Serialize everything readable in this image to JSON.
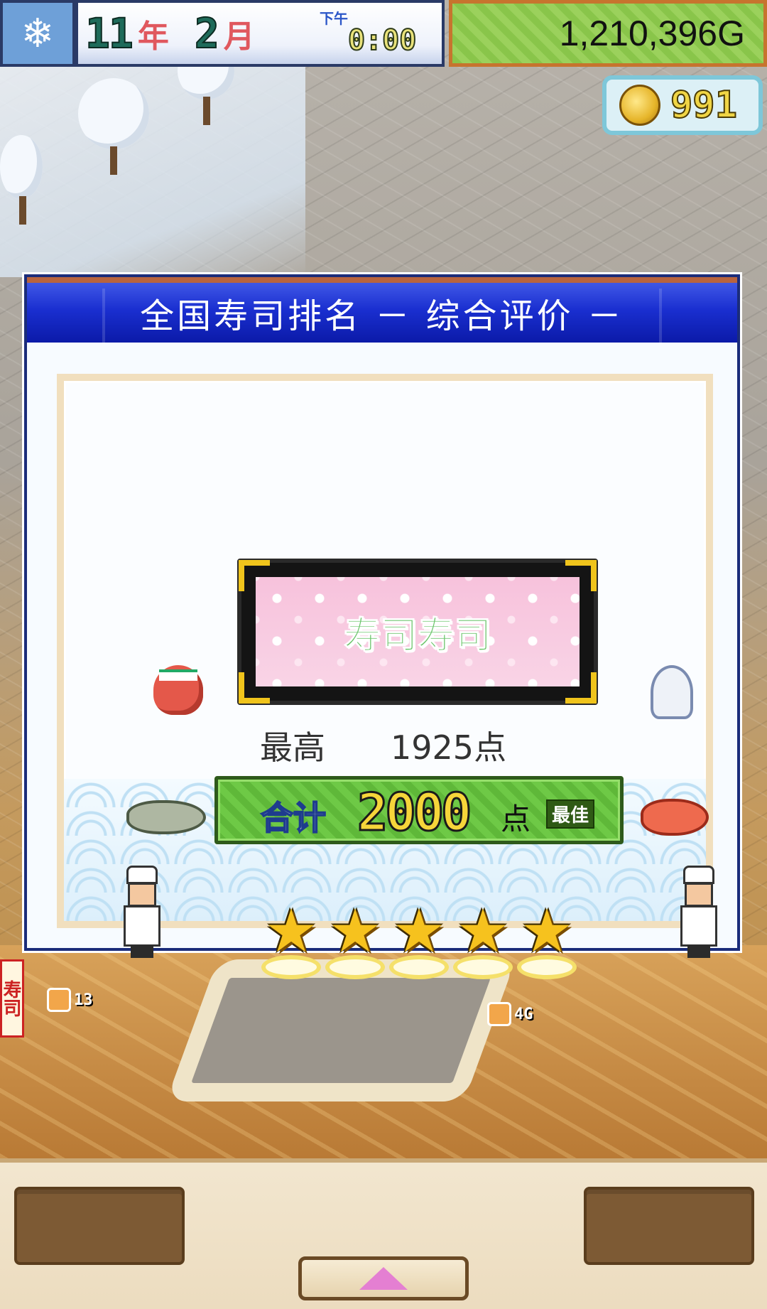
{
  "hud": {
    "weather_icon": "snowflake-icon",
    "year": "11",
    "year_unit": "年",
    "month": "2",
    "month_unit": "月",
    "period": "下午",
    "time": "0:00",
    "money": "1,210,396G",
    "coins": "991"
  },
  "world": {
    "side_banner": "寿司",
    "stall_badges": [
      "13",
      "4G"
    ]
  },
  "dialog": {
    "title": "全国寿司排名 － 综合评价 －",
    "shop_name": "寿司寿司",
    "best_label": "最高",
    "best_value": "1925点",
    "total_label": "合计",
    "total_value": "2000",
    "total_unit": "点",
    "best_badge": "最佳",
    "stars": 5,
    "star_max": 5
  },
  "colors": {
    "header_blue": "#1a2fd0",
    "plaque_pink": "#f7c2dc",
    "total_green": "#5fb839",
    "star_gold": "#f6c21e",
    "money_green": "#89c54a"
  },
  "bottom": {
    "expand_icon": "triangle-up-icon"
  }
}
